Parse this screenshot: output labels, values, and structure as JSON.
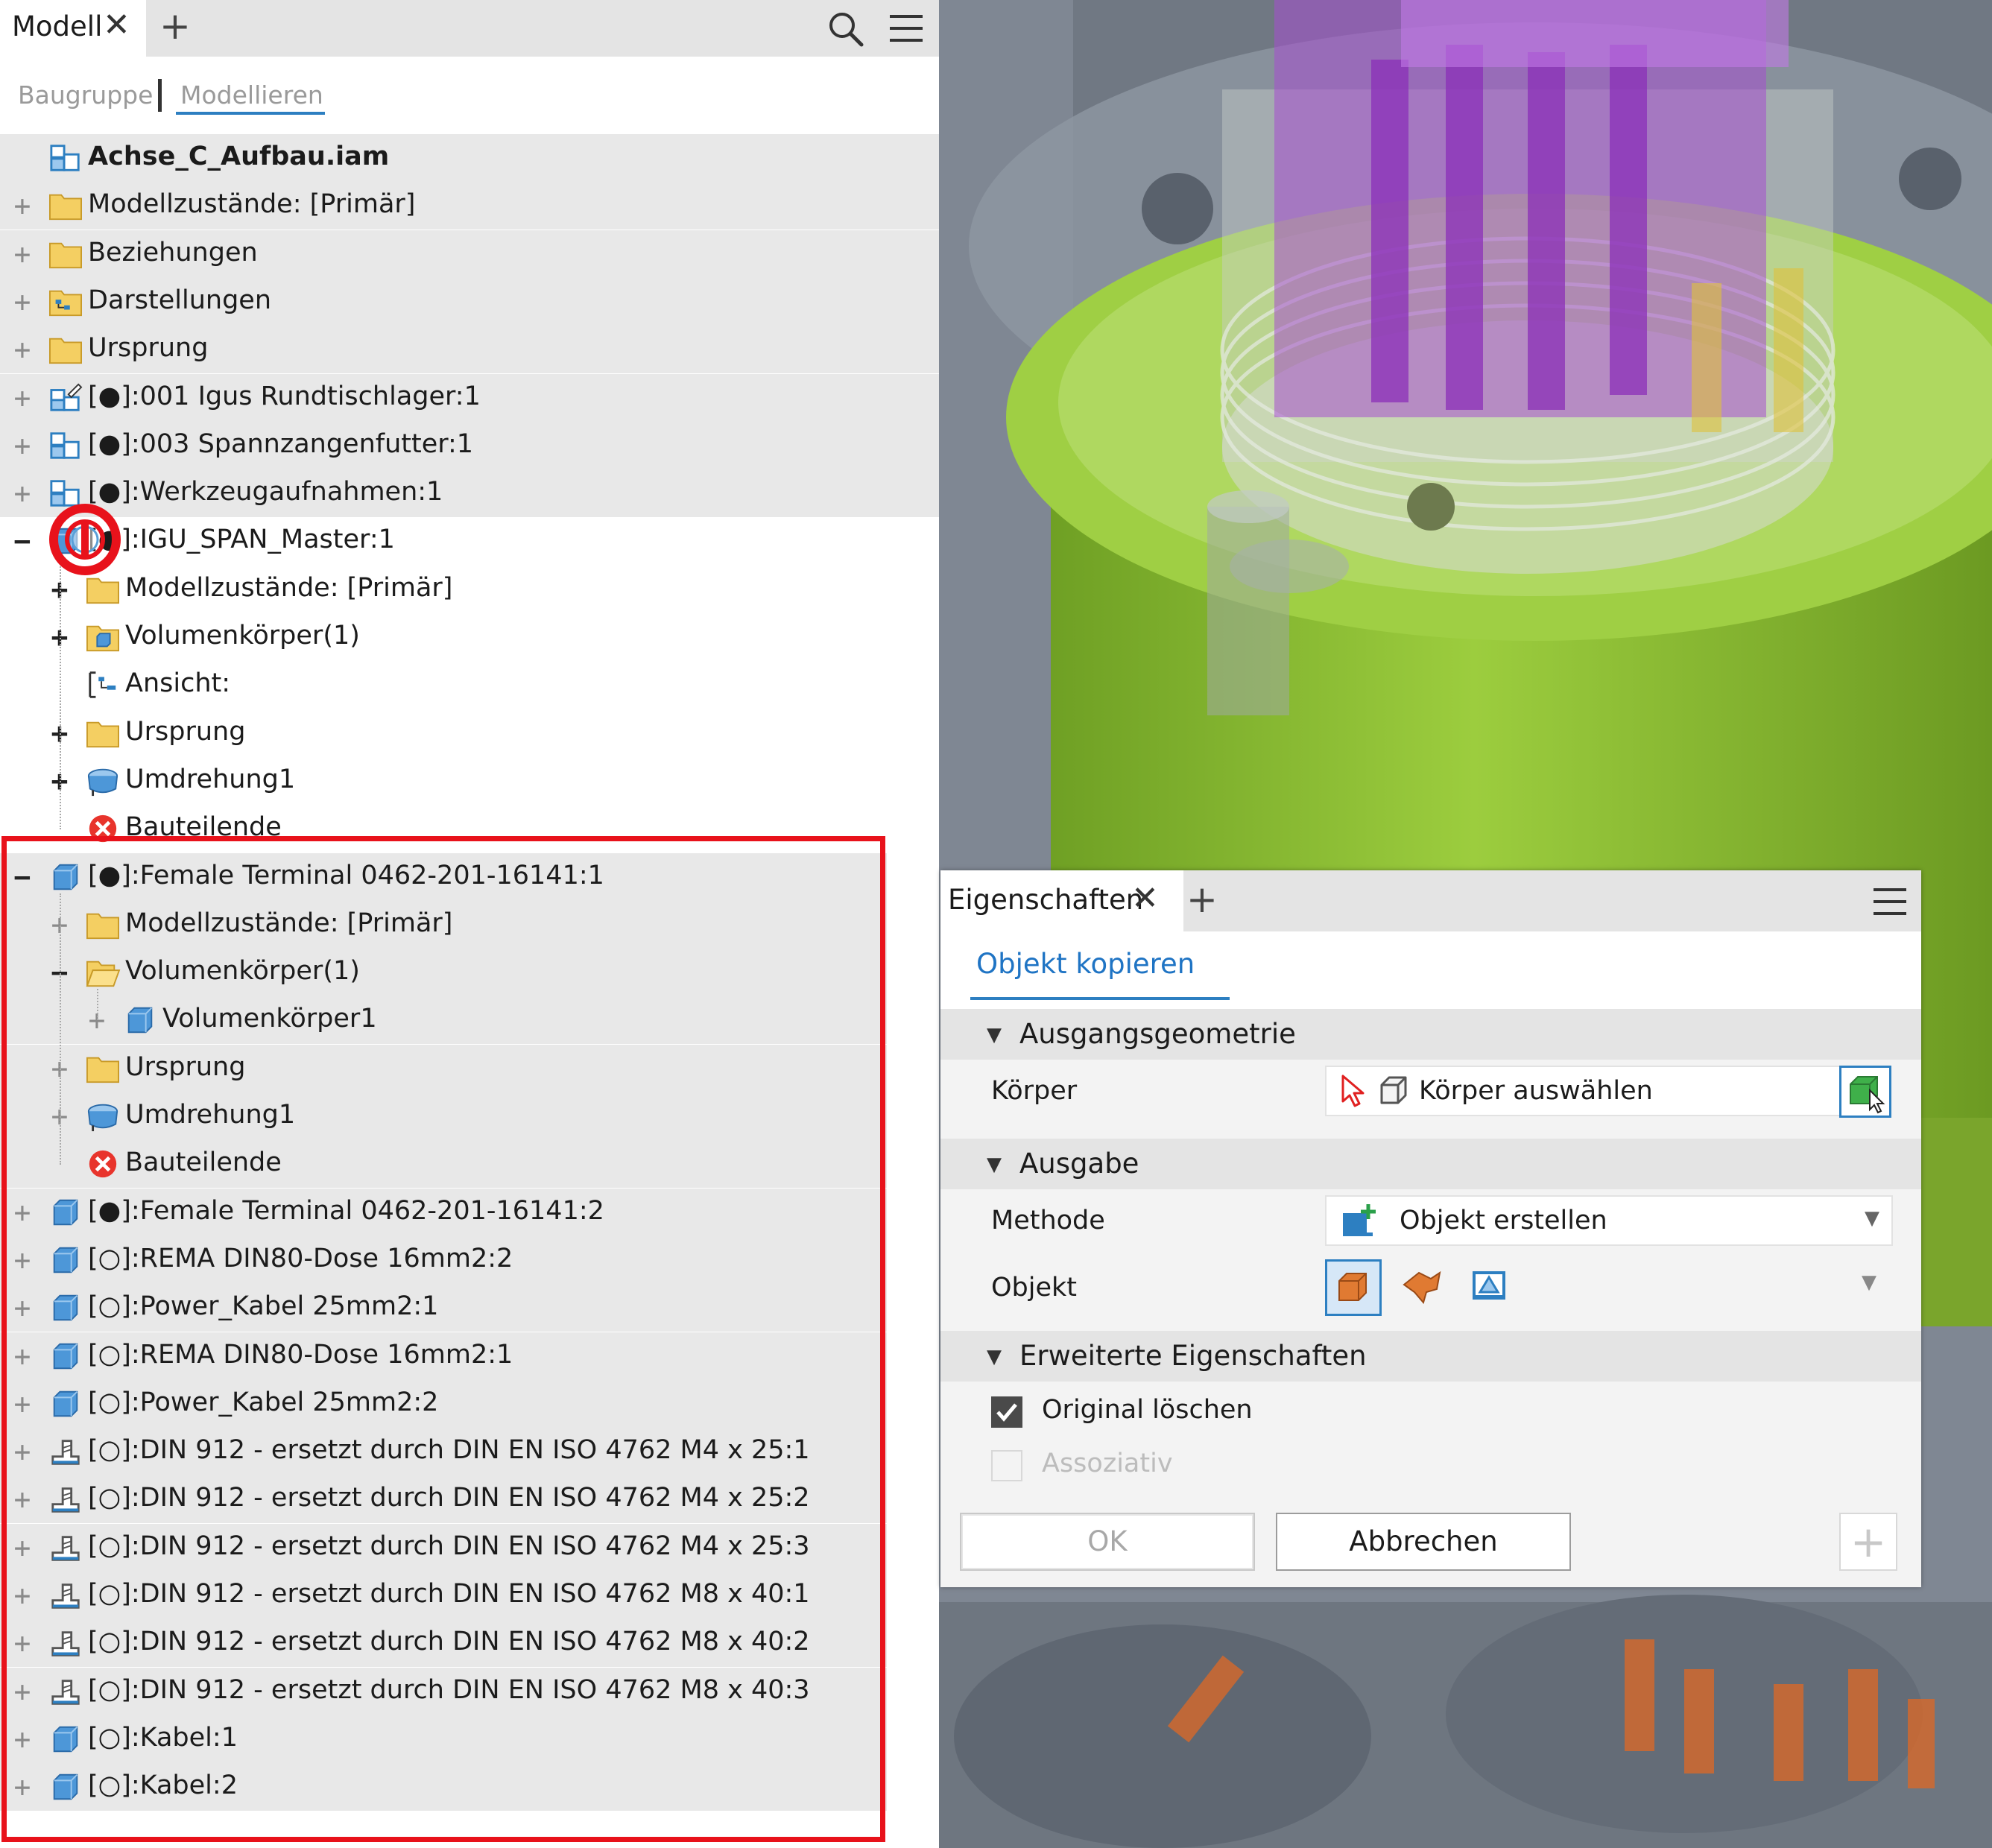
{
  "browser": {
    "tab_label": "Modell",
    "close_glyph": "✕",
    "add_glyph": "+",
    "mode_assembly": "Baugruppe",
    "mode_modeling": "Modellieren",
    "search_icon": "magnifier-icon",
    "menu_icon": "hamburger-icon",
    "tree": [
      {
        "label": "Achse_C_Aufbau.iam",
        "icon": "assembly-icon",
        "expander": "",
        "bold": true
      },
      {
        "label": "Modellzustände: [Primär]",
        "icon": "folder-icon",
        "expander": "+"
      },
      {
        "label": "Beziehungen",
        "icon": "folder-icon",
        "expander": "+"
      },
      {
        "label": "Darstellungen",
        "icon": "representations-folder-icon",
        "expander": "+"
      },
      {
        "label": "Ursprung",
        "icon": "folder-icon",
        "expander": "+"
      },
      {
        "label": "[●]:001 Igus Rundtischlager:1",
        "icon": "subassembly-edit-icon",
        "expander": "+"
      },
      {
        "label": "[●]:003 Spannzangenfutter:1",
        "icon": "subassembly-icon",
        "expander": "+"
      },
      {
        "label": "[●]:Werkzeugaufnahmen:1",
        "icon": "subassembly-icon",
        "expander": "+"
      },
      {
        "label": "[●]:IGU_SPAN_Master:1",
        "icon": "part-icon",
        "expander": "−"
      },
      {
        "label": "Modellzustände: [Primär]",
        "icon": "folder-icon",
        "expander": "+"
      },
      {
        "label": "Volumenkörper(1)",
        "icon": "solid-bodies-folder-icon",
        "expander": "+"
      },
      {
        "label": "Ansicht:",
        "icon": "view-icon",
        "expander": ""
      },
      {
        "label": "Ursprung",
        "icon": "folder-icon",
        "expander": "+"
      },
      {
        "label": "Umdrehung1",
        "icon": "revolve-icon",
        "expander": "+"
      },
      {
        "label": "Bauteilende",
        "icon": "end-of-part-icon",
        "expander": ""
      },
      {
        "label": "[●]:Female Terminal 0462-201-16141:1",
        "icon": "part-icon",
        "expander": "−"
      },
      {
        "label": "Modellzustände: [Primär]",
        "icon": "folder-icon",
        "expander": "+"
      },
      {
        "label": "Volumenkörper(1)",
        "icon": "open-folder-icon",
        "expander": "−"
      },
      {
        "label": "Volumenkörper1",
        "icon": "solid-body-icon",
        "expander": "+"
      },
      {
        "label": "Ursprung",
        "icon": "folder-icon",
        "expander": "+"
      },
      {
        "label": "Umdrehung1",
        "icon": "revolve-icon",
        "expander": "+"
      },
      {
        "label": "Bauteilende",
        "icon": "end-of-part-icon",
        "expander": ""
      },
      {
        "label": "[●]:Female Terminal 0462-201-16141:2",
        "icon": "part-icon",
        "expander": "+"
      },
      {
        "label": "[○]:REMA DIN80-Dose 16mm2:2",
        "icon": "part-icon",
        "expander": "+"
      },
      {
        "label": "[○]:Power_Kabel 25mm2:1",
        "icon": "part-icon",
        "expander": "+"
      },
      {
        "label": "[○]:REMA DIN80-Dose 16mm2:1",
        "icon": "part-icon",
        "expander": "+"
      },
      {
        "label": "[○]:Power_Kabel 25mm2:2",
        "icon": "part-icon",
        "expander": "+"
      },
      {
        "label": "[○]:DIN 912 - ersetzt durch DIN EN ISO 4762 M4 x 25:1",
        "icon": "content-center-part-icon",
        "expander": "+"
      },
      {
        "label": "[○]:DIN 912 - ersetzt durch DIN EN ISO 4762 M4 x 25:2",
        "icon": "content-center-part-icon",
        "expander": "+"
      },
      {
        "label": "[○]:DIN 912 - ersetzt durch DIN EN ISO 4762 M4 x 25:3",
        "icon": "content-center-part-icon",
        "expander": "+"
      },
      {
        "label": "[○]:DIN 912 - ersetzt durch DIN EN ISO 4762 M8 x 40:1",
        "icon": "content-center-part-icon",
        "expander": "+"
      },
      {
        "label": "[○]:DIN 912 - ersetzt durch DIN EN ISO 4762 M8 x 40:2",
        "icon": "content-center-part-icon",
        "expander": "+"
      },
      {
        "label": "[○]:DIN 912 - ersetzt durch DIN EN ISO 4762 M8 x 40:3",
        "icon": "content-center-part-icon",
        "expander": "+"
      },
      {
        "label": "[○]:Kabel:1",
        "icon": "part-icon",
        "expander": "+"
      },
      {
        "label": "[○]:Kabel:2",
        "icon": "part-icon",
        "expander": "+"
      }
    ]
  },
  "properties": {
    "tab_label": "Eigenschaften",
    "close_glyph": "✕",
    "add_glyph": "+",
    "menu_icon": "hamburger-icon",
    "command_title": "Objekt kopieren",
    "section_source": "Ausgangsgeometrie",
    "body_label": "Körper",
    "body_placeholder": "Körper auswählen",
    "section_output": "Ausgabe",
    "method_label": "Methode",
    "method_value": "Objekt erstellen",
    "object_label": "Objekt",
    "section_advanced": "Erweiterte Eigenschaften",
    "delete_original_label": "Original löschen",
    "delete_original_checked": true,
    "associative_label": "Assoziativ",
    "associative_enabled": false,
    "ok_label": "OK",
    "cancel_label": "Abbrechen",
    "plus_glyph": "+",
    "section_arrow": "▼",
    "dropdown_arrow": "▼"
  },
  "colors": {
    "accent": "#2d7fc1",
    "highlight_frame": "#e8121b",
    "model_green": "#8cbd2e",
    "model_purple": "#a64fd0",
    "model_orange": "#d86a2a"
  }
}
